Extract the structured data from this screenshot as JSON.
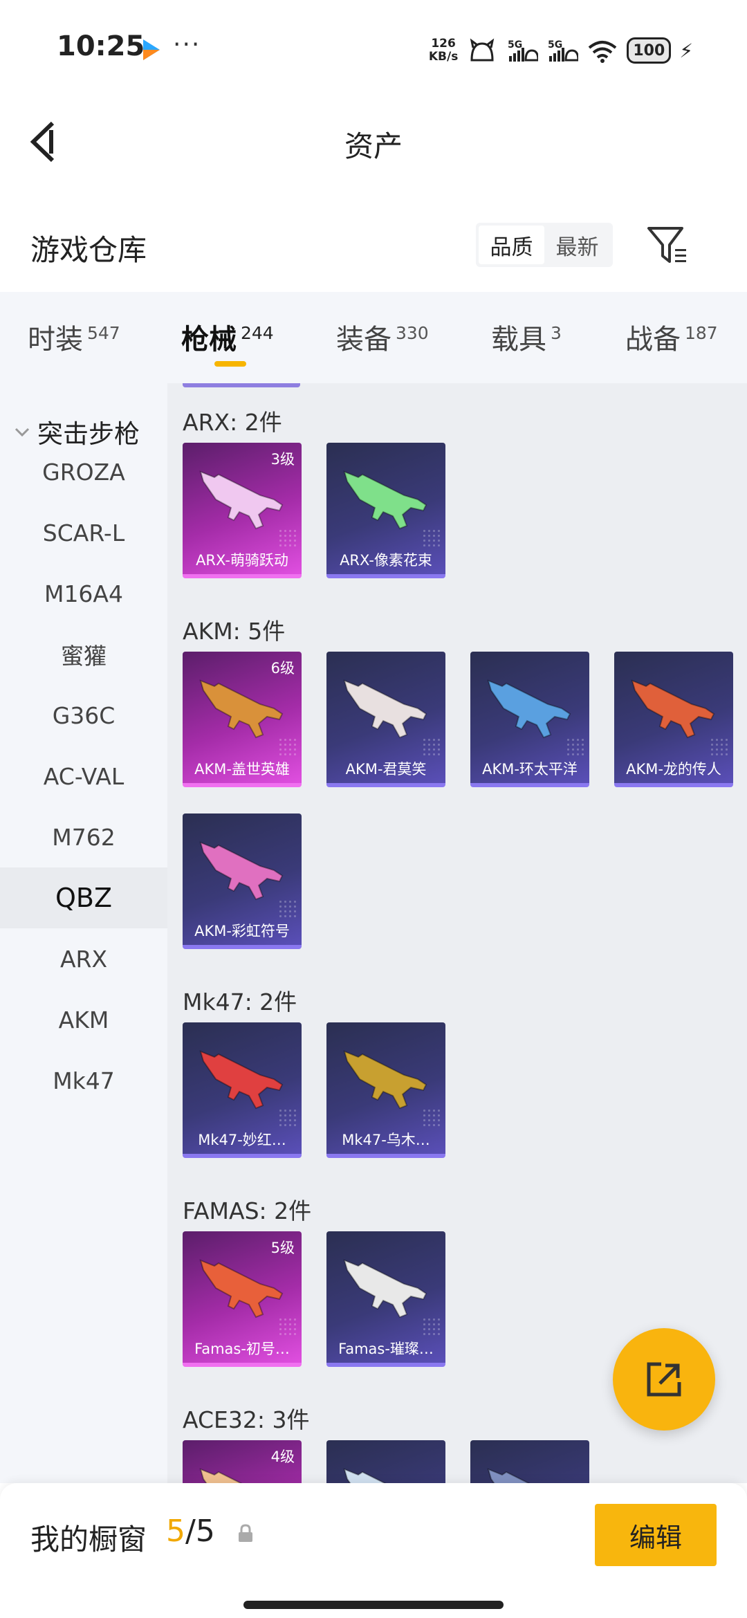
{
  "status_bar": {
    "time": "10:25",
    "dots": "···",
    "net_speed_value": "126",
    "net_speed_unit": "KB/s",
    "battery": "100"
  },
  "header": {
    "title": "资产"
  },
  "section": {
    "title": "游戏仓库",
    "sort_quality": "品质",
    "sort_latest": "最新"
  },
  "tabs": [
    {
      "label": "时装",
      "count": "547"
    },
    {
      "label": "枪械",
      "count": "244"
    },
    {
      "label": "装备",
      "count": "330"
    },
    {
      "label": "载具",
      "count": "3"
    },
    {
      "label": "战备",
      "count": "187"
    }
  ],
  "sidebar": {
    "group": "突击步枪",
    "items": [
      "GROZA",
      "SCAR-L",
      "M16A4",
      "蜜獾",
      "G36C",
      "AC-VAL",
      "M762",
      "QBZ",
      "ARX",
      "AKM",
      "Mk47"
    ],
    "active": "QBZ"
  },
  "groups": [
    {
      "label": "ARX: 2件",
      "items": [
        {
          "name": "ARX-萌骑跃动",
          "level": "3级",
          "rarity": "pink",
          "gun_color": "#f0c8f0"
        },
        {
          "name": "ARX-像素花束",
          "level": "",
          "rarity": "purple",
          "gun_color": "#7fe08a"
        }
      ]
    },
    {
      "label": "AKM: 5件",
      "items": [
        {
          "name": "AKM-盖世英雄",
          "level": "6级",
          "rarity": "pink",
          "gun_color": "#d9913a"
        },
        {
          "name": "AKM-君莫笑",
          "level": "",
          "rarity": "purple",
          "gun_color": "#e8e0e0"
        },
        {
          "name": "AKM-环太平洋",
          "level": "",
          "rarity": "purple",
          "gun_color": "#5aa0e0"
        },
        {
          "name": "AKM-龙的传人",
          "level": "",
          "rarity": "purple",
          "gun_color": "#e0603a"
        },
        {
          "name": "AKM-彩虹符号",
          "level": "",
          "rarity": "purple",
          "gun_color": "#e070c0"
        }
      ]
    },
    {
      "label": "Mk47: 2件",
      "items": [
        {
          "name": "Mk47-妙红…",
          "level": "",
          "rarity": "purple",
          "gun_color": "#e04040"
        },
        {
          "name": "Mk47-乌木…",
          "level": "",
          "rarity": "purple",
          "gun_color": "#c8a030"
        }
      ]
    },
    {
      "label": "FAMAS: 2件",
      "items": [
        {
          "name": "Famas-初号…",
          "level": "5级",
          "rarity": "pink",
          "gun_color": "#e8603a"
        },
        {
          "name": "Famas-璀璨…",
          "level": "",
          "rarity": "purple",
          "gun_color": "#e8e8e8"
        }
      ]
    },
    {
      "label": "ACE32: 3件",
      "items": [
        {
          "name": "",
          "level": "4级",
          "rarity": "pink",
          "gun_color": "#f0c090"
        },
        {
          "name": "",
          "level": "",
          "rarity": "purple",
          "gun_color": "#d0e0f0"
        },
        {
          "name": "",
          "level": "",
          "rarity": "purple",
          "gun_color": "#8090c0"
        }
      ]
    }
  ],
  "showcase": {
    "title": "我的橱窗",
    "current": "5",
    "separator": "/",
    "total": "5",
    "edit_label": "编辑"
  },
  "colors": {
    "accent": "#f8b60d",
    "pink_card": "#a42ca8",
    "purple_card": "#3a3a78"
  }
}
